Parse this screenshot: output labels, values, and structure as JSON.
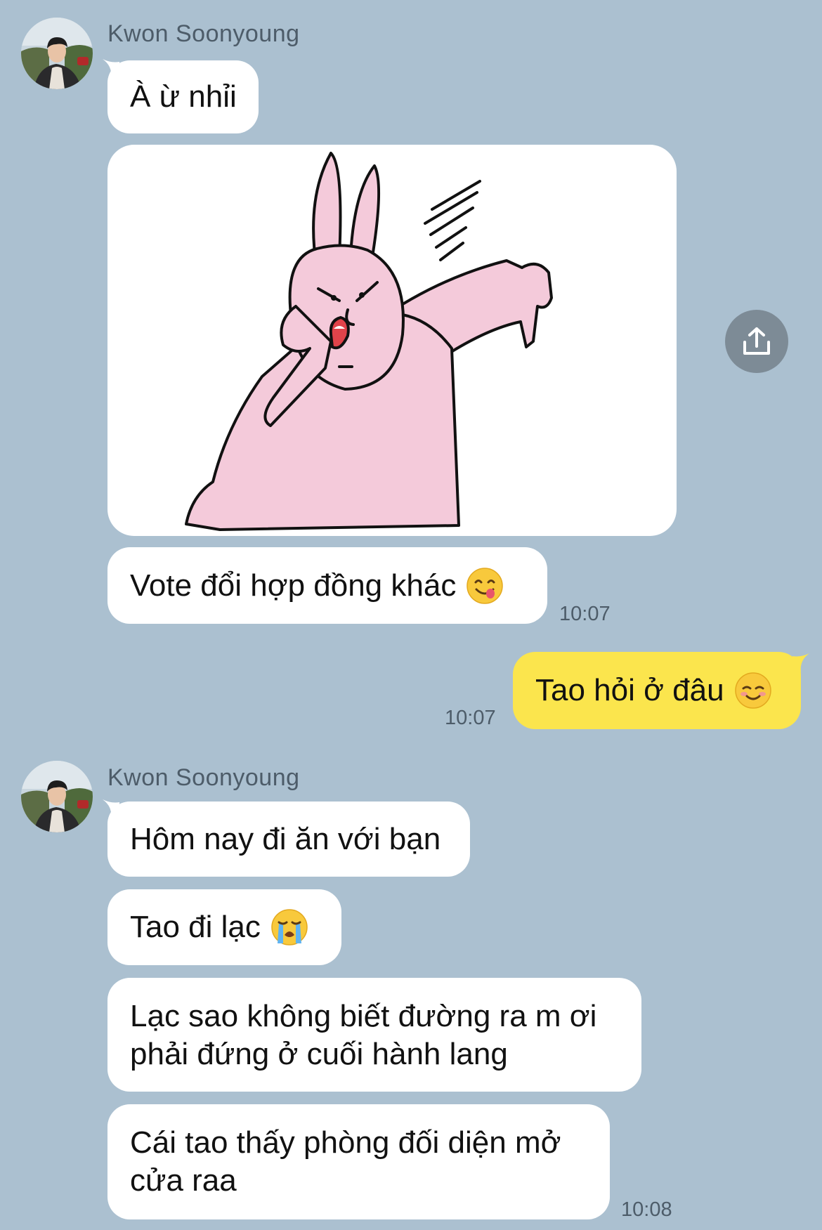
{
  "chat": {
    "first_group": {
      "sender": "Kwon Soonyoung",
      "message_1": "À ừ nhỉi",
      "message_2": "Vote đổi hợp đồng khác",
      "time": "10:07"
    },
    "my_message": {
      "text": "Tao hỏi ở đâu",
      "time": "10:07"
    },
    "second_group": {
      "sender": "Kwon Soonyoung",
      "message_1": "Hôm nay đi ăn với bạn",
      "message_2": "Tao đi lạc",
      "message_3_line_1": "Lạc sao không biết đường ra m ơi",
      "message_3_line_2": "phải đứng ở cuối hành lang",
      "message_4_line_1": "Cái tao thấy phòng đối diện mở",
      "message_4_line_2": "cửa raa",
      "time": "10:08"
    }
  },
  "colors": {
    "background": "#abc0d0",
    "bubble_other": "#ffffff",
    "bubble_mine": "#fbe54d",
    "meta_text": "#4d5c69",
    "share_button": "#7d8b96"
  },
  "icons": {
    "share": "share-upload-icon",
    "sticker": "pink-rabbit-thumbs-down-sticker",
    "emoji_yum": "face-savoring-food-emoji",
    "emoji_smile": "smiling-face-emoji",
    "emoji_cry": "loudly-crying-face-emoji"
  }
}
